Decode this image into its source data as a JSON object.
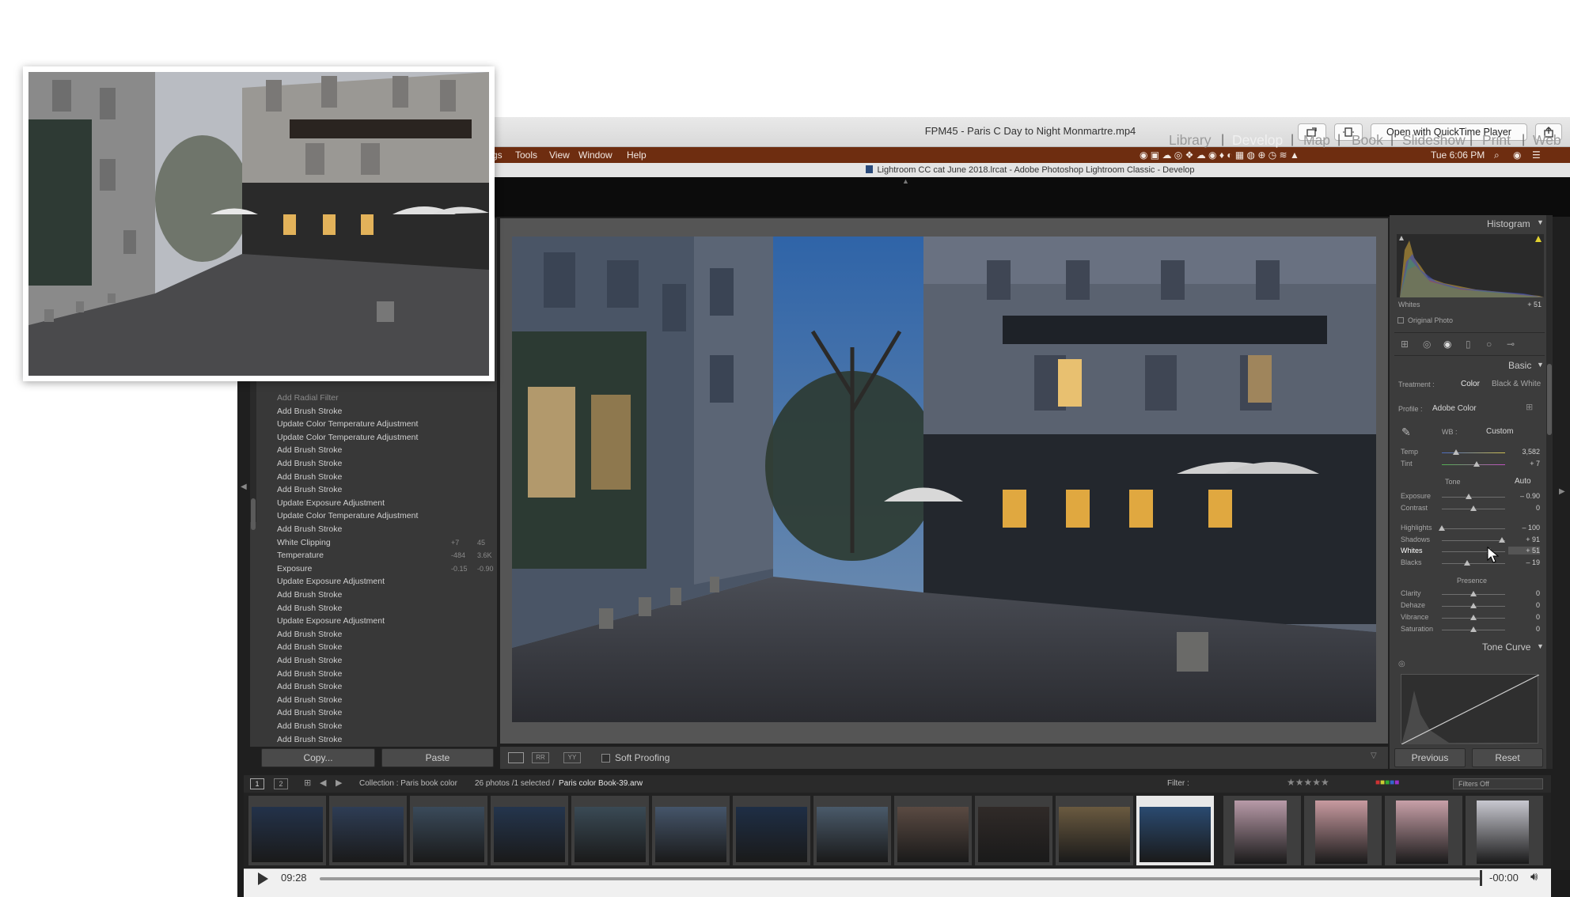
{
  "window": {
    "title": "FPM45 - Paris C Day to Night Monmartre.mp4",
    "open_button": "Open with QuickTime Player"
  },
  "menubar": {
    "items": [
      "gs",
      "Tools",
      "View",
      "Window",
      "Help"
    ],
    "clock": "Tue 6:06 PM"
  },
  "lr_title": "Lightroom CC cat June 2018.lrcat - Adobe Photoshop Lightroom Classic - Develop",
  "modules": [
    "Library",
    "Develop",
    "Map",
    "Book",
    "Slideshow",
    "Print",
    "Web"
  ],
  "history": {
    "items": [
      {
        "label": "Add Radial Filter"
      },
      {
        "label": "Add Brush Stroke"
      },
      {
        "label": "Update Color Temperature Adjustment"
      },
      {
        "label": "Update Color Temperature Adjustment"
      },
      {
        "label": "Add Brush Stroke"
      },
      {
        "label": "Add Brush Stroke"
      },
      {
        "label": "Add Brush Stroke"
      },
      {
        "label": "Add Brush Stroke"
      },
      {
        "label": "Update Exposure Adjustment"
      },
      {
        "label": "Update Color Temperature Adjustment"
      },
      {
        "label": "Add Brush Stroke"
      },
      {
        "label": "White Clipping",
        "from": "+7",
        "to": "45"
      },
      {
        "label": "Temperature",
        "from": "-484",
        "to": "3.6K"
      },
      {
        "label": "Exposure",
        "from": "-0.15",
        "to": "-0.90"
      },
      {
        "label": "Update Exposure Adjustment"
      },
      {
        "label": "Add Brush Stroke"
      },
      {
        "label": "Add Brush Stroke"
      },
      {
        "label": "Update Exposure Adjustment"
      },
      {
        "label": "Add Brush Stroke"
      },
      {
        "label": "Add Brush Stroke"
      },
      {
        "label": "Add Brush Stroke"
      },
      {
        "label": "Add Brush Stroke"
      },
      {
        "label": "Add Brush Stroke"
      },
      {
        "label": "Add Brush Stroke"
      },
      {
        "label": "Add Brush Stroke"
      },
      {
        "label": "Add Brush Stroke"
      },
      {
        "label": "Add Brush Stroke"
      }
    ],
    "copy": "Copy...",
    "paste": "Paste"
  },
  "toolbar": {
    "soft_proofing": "Soft Proofing"
  },
  "right": {
    "histogram": "Histogram",
    "hist_label": "Whites",
    "hist_value": "+ 51",
    "original_photo": "Original Photo",
    "basic": "Basic",
    "treatment_label": "Treatment :",
    "color": "Color",
    "bw": "Black & White",
    "profile_label": "Profile :",
    "profile_value": "Adobe Color",
    "wb_label": "WB :",
    "wb_value": "Custom",
    "tone_label": "Tone",
    "auto": "Auto",
    "presence_label": "Presence",
    "tone_curve": "Tone Curve",
    "previous": "Previous",
    "reset": "Reset",
    "sliders": [
      {
        "label": "Temp",
        "value": "3,582",
        "pos": 0.22
      },
      {
        "label": "Tint",
        "value": "+ 7",
        "pos": 0.55
      },
      {
        "label": "Exposure",
        "value": "– 0.90",
        "pos": 0.42
      },
      {
        "label": "Contrast",
        "value": "0",
        "pos": 0.5
      },
      {
        "label": "Highlights",
        "value": "– 100",
        "pos": 0.0
      },
      {
        "label": "Shadows",
        "value": "+ 91",
        "pos": 0.95
      },
      {
        "label": "Whites",
        "value": "+ 51",
        "pos": 0.76
      },
      {
        "label": "Blacks",
        "value": "– 19",
        "pos": 0.4
      },
      {
        "label": "Clarity",
        "value": "0",
        "pos": 0.5
      },
      {
        "label": "Dehaze",
        "value": "0",
        "pos": 0.5
      },
      {
        "label": "Vibrance",
        "value": "0",
        "pos": 0.5
      },
      {
        "label": "Saturation",
        "value": "0",
        "pos": 0.5
      }
    ]
  },
  "filmstrip": {
    "page1": "1",
    "page2": "2",
    "collection": "Collection : Paris book color",
    "count": "26 photos /1 selected /",
    "filename": "Paris color Book-39.arw",
    "filter_label": "Filter :",
    "filters_off": "Filters Off"
  },
  "player": {
    "elapsed": "09:28",
    "remaining": "-00:00"
  },
  "colors": {
    "menubar": "#6e2d10",
    "accent_selected": "#ffffff"
  }
}
